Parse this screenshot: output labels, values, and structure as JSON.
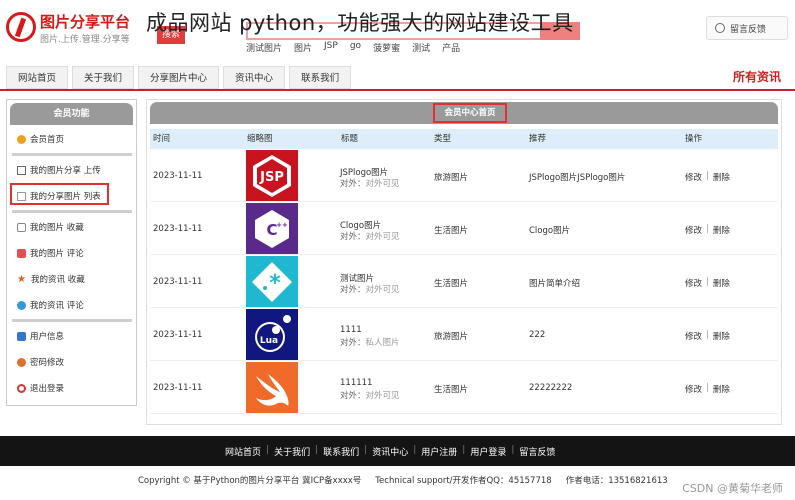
{
  "header": {
    "logo_title": "图片分享平台",
    "logo_subtitle": "图片.上传.管理.分享等",
    "overlay_title": "成品网站 python，功能强大的网站建设工具",
    "tag_label": "搜索",
    "hot_links": [
      "测试图片",
      "图片",
      "JSP",
      "go",
      "菠萝蜜",
      "测试",
      "产品"
    ],
    "feedback_label": "留言反馈"
  },
  "nav": {
    "items": [
      "网站首页",
      "关于我们",
      "分享图片中心",
      "资讯中心",
      "联系我们"
    ],
    "right_label": "所有资讯"
  },
  "sidebar": {
    "title": "会员功能",
    "items": [
      {
        "label": "会员首页",
        "icon": "user-home-icon",
        "color": "#f0a020"
      },
      {
        "label": "我的图片分享 上传",
        "icon": "upload-icon",
        "color": "#666666"
      },
      {
        "label": "我的分享图片 列表",
        "icon": "list-icon",
        "color": "#999999"
      },
      {
        "label": "我的图片 收藏",
        "icon": "star-outline-icon",
        "color": "#888888"
      },
      {
        "label": "我的图片 评论",
        "icon": "comment-icon",
        "color": "#e05050"
      },
      {
        "label": "我的资讯 收藏",
        "icon": "star-icon",
        "color": "#e06020"
      },
      {
        "label": "我的资讯 评论",
        "icon": "chat-icon",
        "color": "#3399dd"
      },
      {
        "label": "用户信息",
        "icon": "user-info-icon",
        "color": "#3377cc"
      },
      {
        "label": "密码修改",
        "icon": "lock-icon",
        "color": "#e07030"
      },
      {
        "label": "退出登录",
        "icon": "power-icon",
        "color": "#dd3333"
      }
    ]
  },
  "main": {
    "title": "会员中心首页",
    "columns": [
      "时间",
      "缩略图",
      "标题",
      "类型",
      "推荐",
      "操作"
    ],
    "visibility_label": "对外：",
    "edit_label": "修改",
    "delete_label": "删除",
    "rows": [
      {
        "time": "2023-11-11",
        "thumb": "jsp-logo",
        "title": "JSPlogo图片",
        "visibility": "对外可见",
        "type": "旅游图片",
        "recommend": "JSPlogo图片JSPlogo图片"
      },
      {
        "time": "2023-11-11",
        "thumb": "cpp-logo",
        "title": "Clogo图片",
        "visibility": "对外可见",
        "type": "生活图片",
        "recommend": "Clogo图片"
      },
      {
        "time": "2023-11-11",
        "thumb": "asterisk-logo",
        "title": "测试图片",
        "visibility": "对外可见",
        "type": "生活图片",
        "recommend": "图片简单介绍"
      },
      {
        "time": "2023-11-11",
        "thumb": "lua-logo",
        "title": "1111",
        "visibility": "私人图片",
        "type": "旅游图片",
        "recommend": "222"
      },
      {
        "time": "2023-11-11",
        "thumb": "swift-logo",
        "title": "111111",
        "visibility": "对外可见",
        "type": "生活图片",
        "recommend": "22222222"
      }
    ]
  },
  "footer": {
    "links": [
      "网站首页",
      "关于我们",
      "联系我们",
      "资讯中心",
      "用户注册",
      "用户登录",
      "留言反馈"
    ],
    "copyright": "Copyright © 基于Python的图片分享平台 冀ICP备xxxx号",
    "support": "Technical support/开发作者QQ：45157718",
    "phone": "作者电话：13516821613",
    "watermark": "CSDN @黄菊华老师"
  }
}
